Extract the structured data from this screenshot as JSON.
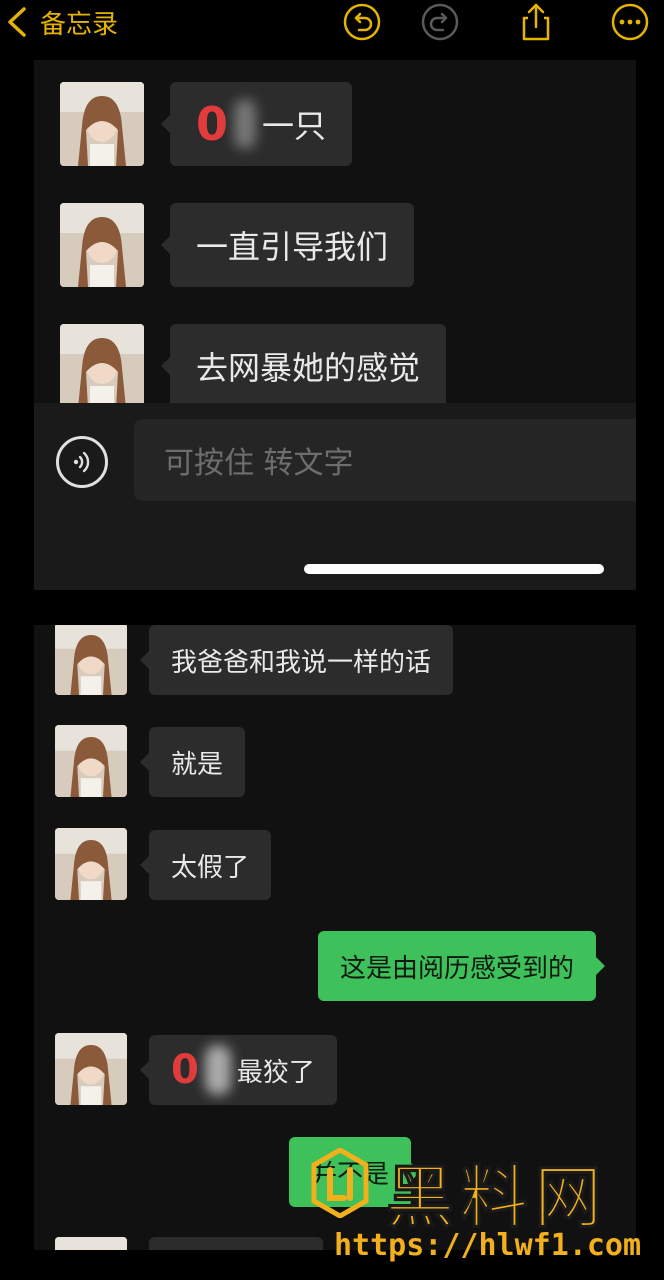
{
  "toolbar": {
    "back_label": "备忘录",
    "accent": "#e6b400",
    "icons": [
      "undo-icon",
      "redo-icon",
      "share-icon",
      "more-icon"
    ]
  },
  "panel_a": {
    "messages": [
      {
        "side": "left",
        "mark": "0",
        "text": "一只"
      },
      {
        "side": "left",
        "text": "一直引导我们"
      },
      {
        "side": "left",
        "text": "去网暴她的感觉"
      }
    ],
    "input": {
      "placeholder": "可按住 转文字"
    }
  },
  "panel_b": {
    "messages": [
      {
        "side": "left",
        "text": "我爸爸和我说一样的话"
      },
      {
        "side": "left",
        "text": "就是"
      },
      {
        "side": "left",
        "text": "太假了"
      },
      {
        "side": "right",
        "text": "这是由阅历感受到的"
      },
      {
        "side": "left",
        "mark": "0",
        "text": "最狡了"
      },
      {
        "side": "right",
        "text": "并不是"
      }
    ]
  },
  "watermark": {
    "title": "黑料网",
    "url": "https://hlwf1.com",
    "color": "#f2b01c"
  }
}
